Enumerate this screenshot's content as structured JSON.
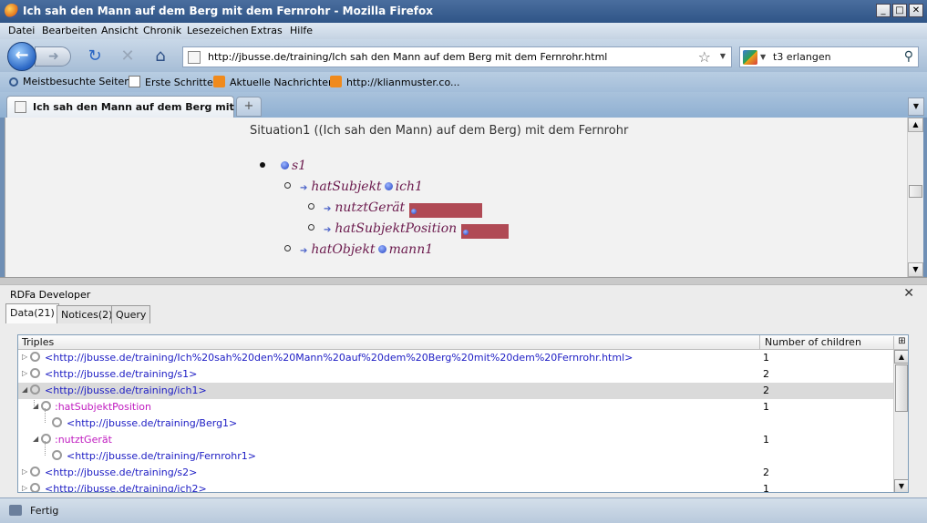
{
  "window": {
    "title": "Ich sah den Mann auf dem Berg mit dem Fernrohr - Mozilla Firefox",
    "controls": {
      "minimize": "_",
      "maximize": "□",
      "close": "✕"
    }
  },
  "menu": [
    "Datei",
    "Bearbeiten",
    "Ansicht",
    "Chronik",
    "Lesezeichen",
    "Extras",
    "Hilfe"
  ],
  "nav": {
    "url": "http://jbusse.de/training/Ich sah den Mann auf dem Berg mit dem Fernrohr.html",
    "search_value": "t3 erlangen",
    "icons": {
      "back": "back-arrow-icon",
      "forward": "forward-arrow-icon",
      "reload": "reload-icon",
      "stop": "stop-icon",
      "home": "home-icon"
    }
  },
  "bookmarks": [
    {
      "label": "Meistbesuchte Seiten",
      "icon": "magnifier-icon"
    },
    {
      "label": "Erste Schritte",
      "icon": "page-icon"
    },
    {
      "label": "Aktuelle Nachrichten",
      "icon": "rss-icon"
    },
    {
      "label": "http://klianmuster.co...",
      "icon": "rss-icon"
    }
  ],
  "tab": {
    "label": "Ich sah den Mann auf dem Berg mit ...",
    "new_tab": "+"
  },
  "page": {
    "heading": "Situation1 ((Ich sah den Mann) auf dem Berg) mit dem Fernrohr",
    "tree": {
      "root": "s1",
      "hatSubjekt": {
        "predicate": "hatSubjekt",
        "object": "ich1"
      },
      "nutztGeraet": "nutztGerät",
      "hatSubjektPosition": "hatSubjektPosition",
      "hatObjekt": {
        "predicate": "hatObjekt",
        "object": "mann1"
      }
    }
  },
  "panel": {
    "title": "RDFa Developer",
    "close": "✕",
    "tabs": [
      "Data(21)",
      "Notices(2)",
      "Query"
    ],
    "columns": {
      "triples": "Triples",
      "children": "Number of children"
    },
    "rows": [
      {
        "label": "<http://jbusse.de/training/Ich%20sah%20den%20Mann%20auf%20dem%20Berg%20mit%20dem%20Fernrohr.html>",
        "count": "1"
      },
      {
        "label": "<http://jbusse.de/training/s1>",
        "count": "2"
      },
      {
        "label": "<http://jbusse.de/training/ich1>",
        "count": "2"
      },
      {
        "label": ":hatSubjektPosition",
        "count": "1"
      },
      {
        "label": "<http://jbusse.de/training/Berg1>",
        "count": ""
      },
      {
        "label": ":nutztGerät",
        "count": "1"
      },
      {
        "label": "<http://jbusse.de/training/Fernrohr1>",
        "count": ""
      },
      {
        "label": "<http://jbusse.de/training/s2>",
        "count": "2"
      },
      {
        "label": "<http://jbusse.de/training/ich2>",
        "count": "1"
      }
    ]
  },
  "status": {
    "text": "Fertig"
  }
}
